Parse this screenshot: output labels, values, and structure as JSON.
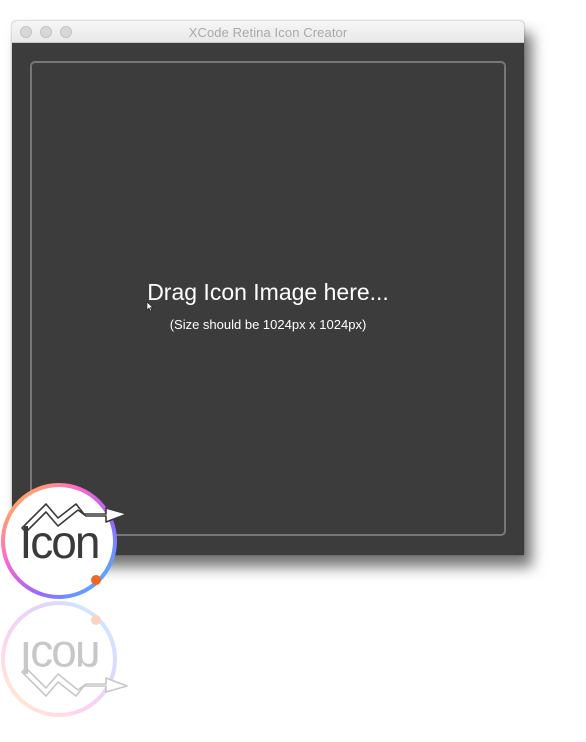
{
  "window": {
    "title": "XCode Retina Icon Creator"
  },
  "dropzone": {
    "title": "Drag Icon Image here...",
    "subtitle": "(Size should be 1024px x 1024px)"
  },
  "app_icon": {
    "label": "Icon",
    "colors": {
      "ring_gradient": [
        "#ffcc33",
        "#ff66cc",
        "#9966ff",
        "#33ccff"
      ],
      "dot": "#f26522"
    }
  }
}
